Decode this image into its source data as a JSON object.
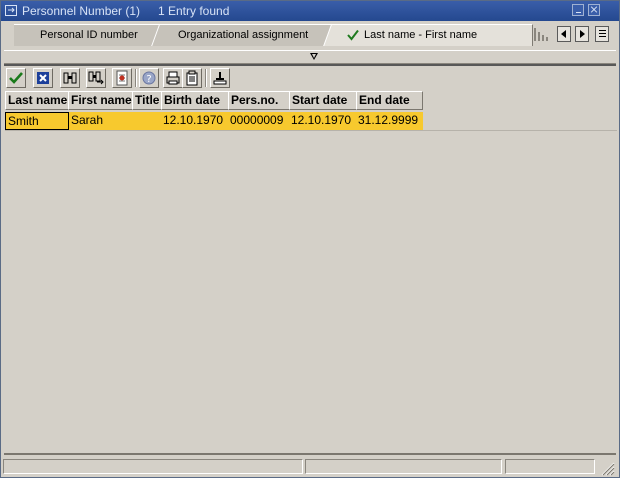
{
  "window": {
    "title": "Personnel Number (1)",
    "result_count": "1 Entry found"
  },
  "tabs": [
    {
      "label": "Personal ID number",
      "active": false
    },
    {
      "label": "Organizational assignment",
      "active": false
    },
    {
      "label": "Last name - First name",
      "active": true
    }
  ],
  "toolbar": {
    "buttons": [
      "check-icon",
      "cancel-icon",
      "find-icon",
      "find-next-icon",
      "personal-list-icon",
      "help-icon",
      "print-icon",
      "clipboard-icon",
      "sort-icon"
    ]
  },
  "table": {
    "columns": [
      "Last name",
      "First name",
      "Title",
      "Birth date",
      "Pers.no.",
      "Start date",
      "End date"
    ],
    "rows": [
      [
        "Smith",
        "Sarah",
        "",
        "12.10.1970",
        "00000009",
        "12.10.1970",
        "31.12.9999"
      ]
    ]
  },
  "colors": {
    "titlebar": "#2c4f98",
    "selected_row": "#f7c92e",
    "background": "#d4d0c8"
  }
}
